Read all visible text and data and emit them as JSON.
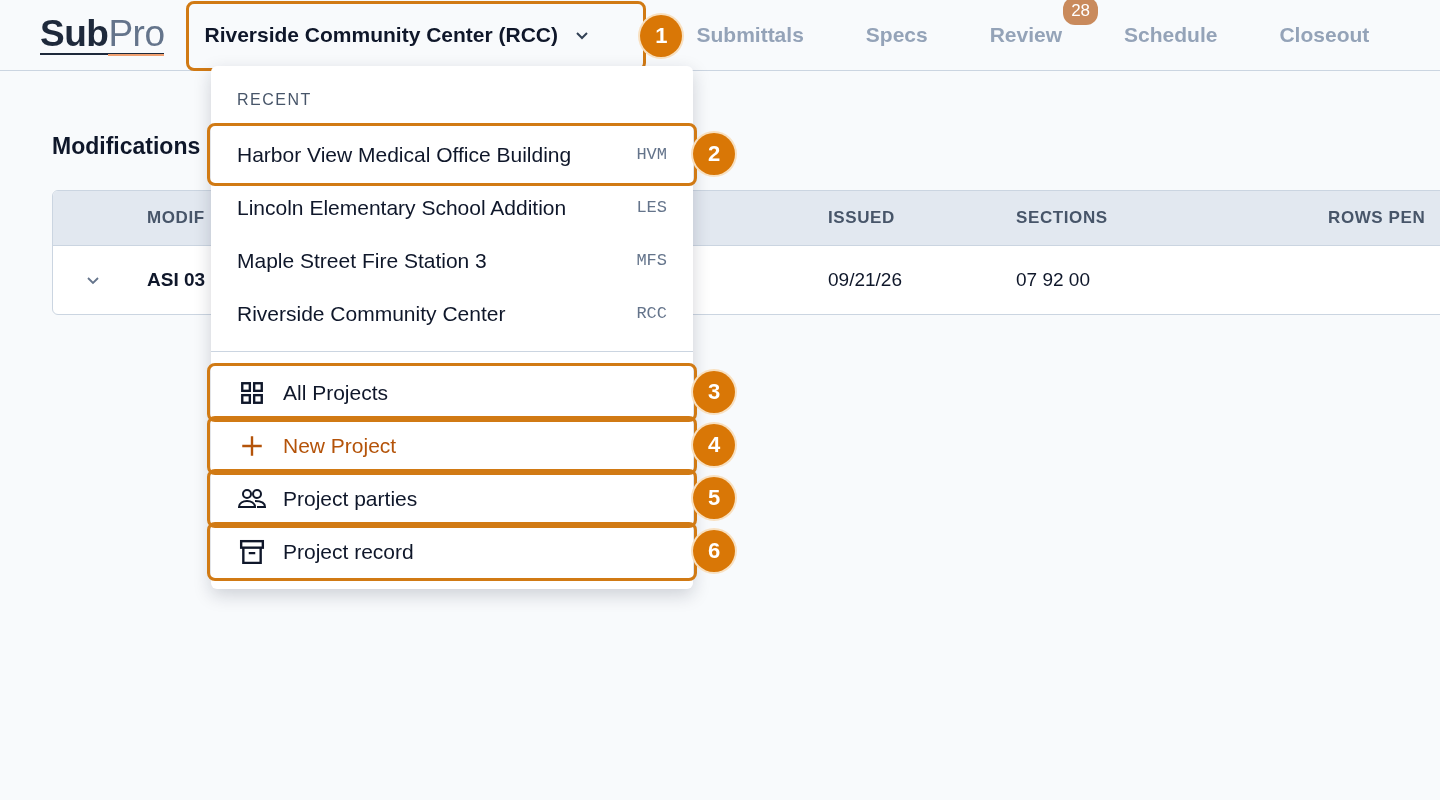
{
  "header": {
    "logo": {
      "first": "Sub",
      "second": "Pro"
    },
    "project_selector": {
      "label": "Riverside Community Center (RCC)",
      "callout": "1"
    },
    "nav": [
      {
        "label": "Submittals"
      },
      {
        "label": "Specs"
      },
      {
        "label": "Review",
        "badge": "28"
      },
      {
        "label": "Schedule"
      },
      {
        "label": "Closeout"
      }
    ]
  },
  "page": {
    "title": "Modifications",
    "table": {
      "columns": [
        "MODIF",
        "ISSUED",
        "SECTIONS",
        "ROWS PEN"
      ],
      "rows": [
        {
          "expanded": false,
          "cells": [
            "ASI 03",
            "09/21/26",
            "07 92 00"
          ]
        }
      ]
    }
  },
  "dropdown": {
    "section_label": "RECENT",
    "recent": [
      {
        "name": "Harbor View Medical Office Building",
        "code": "HVM",
        "callout": "2"
      },
      {
        "name": "Lincoln Elementary School Addition",
        "code": "LES"
      },
      {
        "name": "Maple Street Fire Station 3",
        "code": "MFS"
      },
      {
        "name": "Riverside Community Center",
        "code": "RCC"
      }
    ],
    "actions": [
      {
        "label": "All Projects",
        "kind": "grid",
        "accent": false,
        "callout": "3"
      },
      {
        "label": "New Project",
        "kind": "plus",
        "accent": true,
        "callout": "4"
      },
      {
        "label": "Project parties",
        "kind": "people",
        "accent": false,
        "callout": "5"
      },
      {
        "label": "Project record",
        "kind": "archive",
        "accent": false,
        "callout": "6"
      }
    ]
  }
}
